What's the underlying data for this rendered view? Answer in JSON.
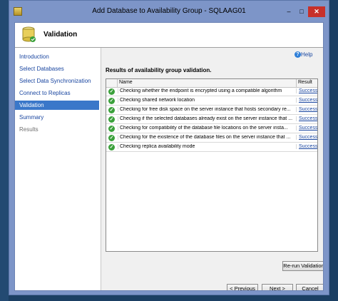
{
  "window": {
    "title": "Add Database to Availability Group - SQLAAG01",
    "min_label": "–",
    "max_label": "□",
    "close_label": "✕"
  },
  "header": {
    "title": "Validation"
  },
  "sidebar": {
    "items": [
      {
        "label": "Introduction",
        "state": "normal"
      },
      {
        "label": "Select Databases",
        "state": "normal"
      },
      {
        "label": "Select Data Synchronization",
        "state": "normal"
      },
      {
        "label": "Connect to Replicas",
        "state": "normal"
      },
      {
        "label": "Validation",
        "state": "active"
      },
      {
        "label": "Summary",
        "state": "normal"
      },
      {
        "label": "Results",
        "state": "disabled"
      }
    ]
  },
  "help": {
    "label": "Help",
    "icon": "?"
  },
  "results": {
    "title": "Results of availability group validation.",
    "columns": {
      "name": "Name",
      "result": "Result"
    },
    "rows": [
      {
        "name": "Checking whether the endpoint is encrypted using a compatible algorithm",
        "result": "Success"
      },
      {
        "name": "Checking shared network location",
        "result": "Success"
      },
      {
        "name": "Checking for free disk space on the server instance that hosts secondary re...",
        "result": "Success"
      },
      {
        "name": "Checking if the selected databases already exist on the server instance that ...",
        "result": "Success"
      },
      {
        "name": "Checking for compatibility of the database file locations on the server insta...",
        "result": "Success"
      },
      {
        "name": "Checking for the existence of the database files on the server instance that ...",
        "result": "Success"
      },
      {
        "name": "Checking replica availability mode",
        "result": "Success"
      }
    ]
  },
  "buttons": {
    "rerun": "Re-run Validation",
    "previous": "< Previous",
    "next": "Next >",
    "cancel": "Cancel"
  },
  "colors": {
    "accent": "#3a77c9",
    "success": "#3aa03a",
    "link": "#1a46a0",
    "close": "#c7302a"
  }
}
